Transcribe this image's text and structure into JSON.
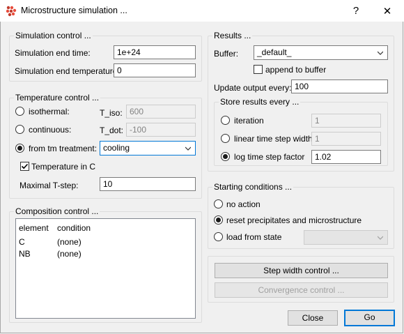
{
  "window": {
    "title": "Microstructure simulation ...",
    "help_label": "?",
    "close_label": "✕"
  },
  "simulation_control": {
    "legend": "Simulation control ...",
    "end_time_label": "Simulation end time:",
    "end_time_value": "1e+24",
    "end_temp_label": "Simulation end temperature:",
    "end_temp_value": "0"
  },
  "temperature_control": {
    "legend": "Temperature control ...",
    "isothermal_label": "isothermal:",
    "t_iso_label": "T_iso:",
    "t_iso_value": "600",
    "continuous_label": "continuous:",
    "t_dot_label": "T_dot:",
    "t_dot_value": "-100",
    "from_tm_label": "from tm treatment:",
    "treatment_value": "cooling",
    "temp_in_c_label": "Temperature in C",
    "max_tstep_label": "Maximal T-step:",
    "max_tstep_value": "10",
    "selected": "from tm treatment"
  },
  "composition_control": {
    "legend": "Composition control ...",
    "columns": [
      "element",
      "condition"
    ],
    "rows": [
      [
        "C",
        "(none)"
      ],
      [
        "NB",
        "(none)"
      ]
    ]
  },
  "results": {
    "legend": "Results ...",
    "buffer_label": "Buffer:",
    "buffer_value": "_default_",
    "append_label": "append to buffer",
    "update_label": "Update output every:",
    "update_value": "100",
    "store": {
      "legend": "Store results every ...",
      "iteration_label": "iteration",
      "iteration_value": "1",
      "linear_label": "linear time step width",
      "linear_value": "1",
      "log_label": "log time step factor",
      "log_value": "1.02",
      "selected": "log time step factor"
    }
  },
  "starting_conditions": {
    "legend": "Starting conditions ...",
    "no_action_label": "no action",
    "reset_label": "reset precipitates and microstructure",
    "load_label": "load from state",
    "state_value": "",
    "selected": "reset precipitates and microstructure"
  },
  "buttons": {
    "step_width": "Step width control ...",
    "convergence": "Convergence control ...",
    "close": "Close",
    "go": "Go"
  },
  "checkboxes": {
    "temperature_in_c": true,
    "append_to_buffer": false
  }
}
